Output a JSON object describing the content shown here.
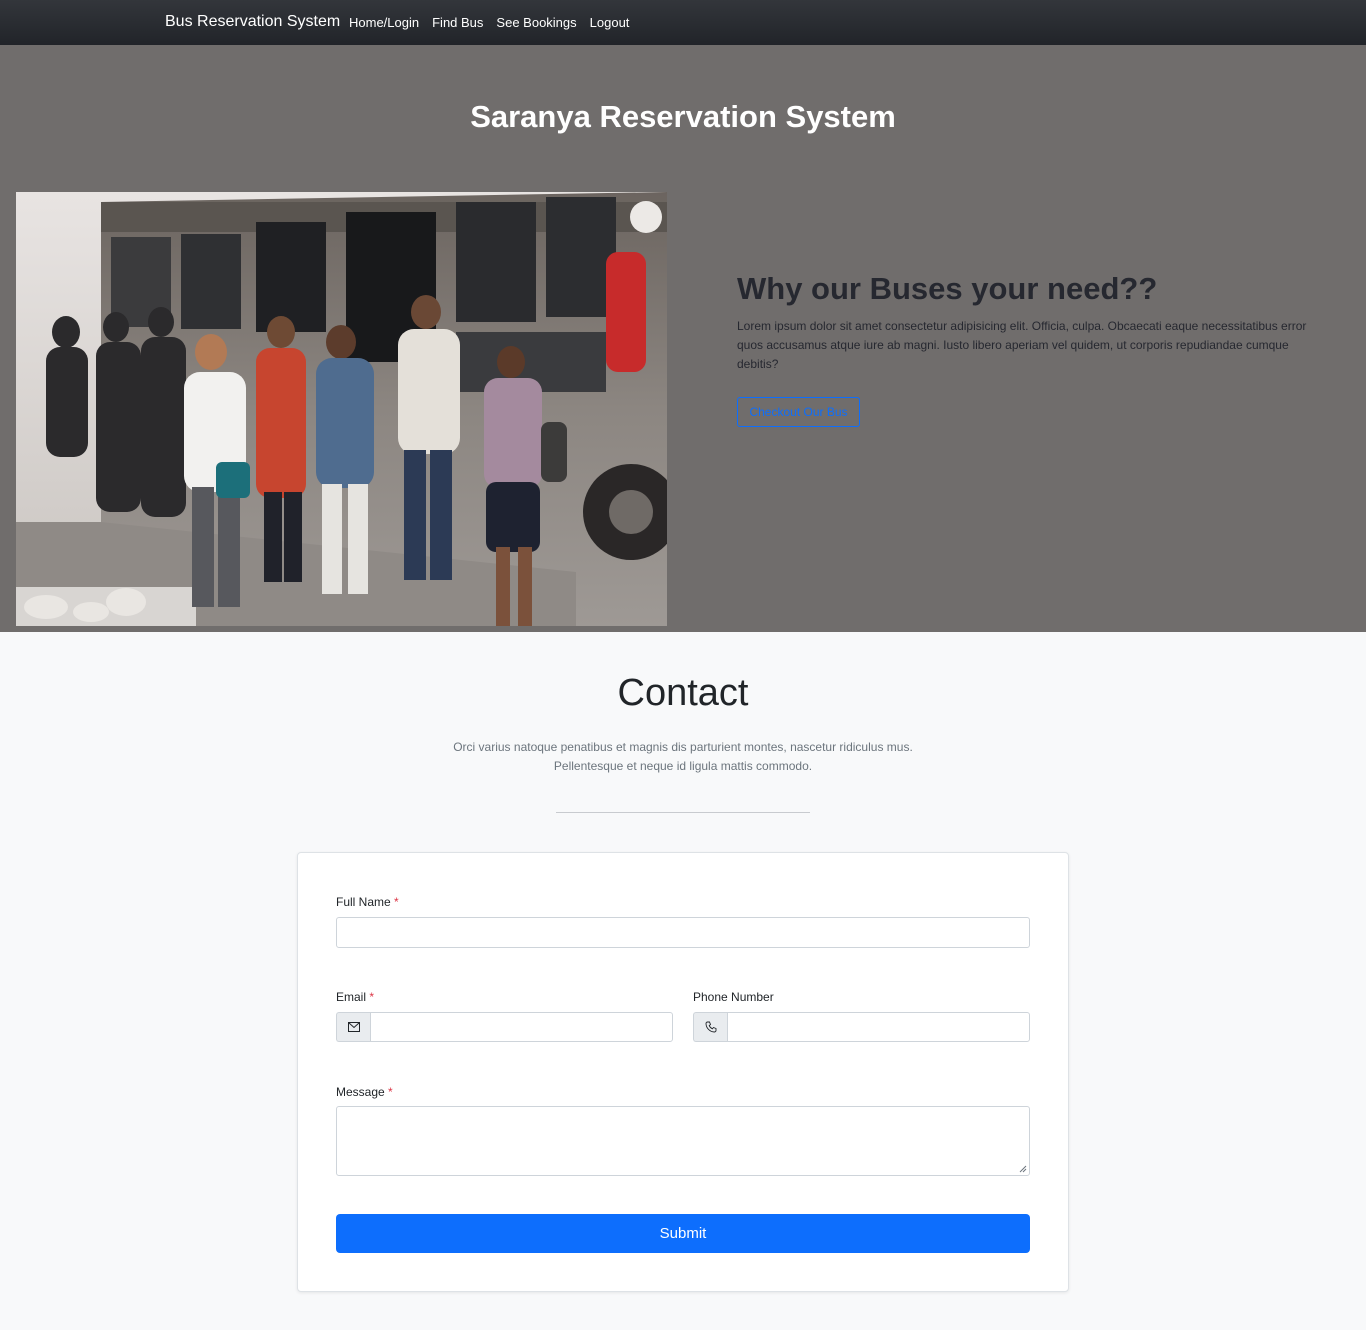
{
  "navbar": {
    "brand": "Bus Reservation System",
    "links": [
      "Home/Login",
      "Find Bus",
      "See Bookings",
      "Logout"
    ]
  },
  "hero": {
    "title": "Saranya Reservation System",
    "heading": "Why our Buses your need??",
    "text": "Lorem ipsum dolor sit amet consectetur adipisicing elit. Officia, culpa. Obcaecati eaque necessitatibus error quos accusamus atque iure ab magni. Iusto libero aperiam vel quidem, ut corporis repudiandae cumque debitis?",
    "button_label": "Checkout Our Bus"
  },
  "contact": {
    "title": "Contact",
    "subtitle_line1": "Orci varius natoque penatibus et magnis dis parturient montes, nascetur ridiculus mus.",
    "subtitle_line2": "Pellentesque et neque id ligula mattis commodo.",
    "form": {
      "full_name_label": "Full Name",
      "email_label": "Email",
      "phone_label": "Phone Number",
      "message_label": "Message",
      "required_mark": "*",
      "full_name_value": "",
      "email_value": "",
      "phone_value": "",
      "message_value": "",
      "submit_label": "Submit"
    }
  },
  "colors": {
    "navbar_bg": "#212429",
    "hero_bg": "#706d6c",
    "primary": "#0d6efd",
    "required": "#dc3545",
    "page_bg": "#f8f9fa"
  },
  "icons": {
    "email": "envelope-icon",
    "phone": "telephone-icon"
  }
}
